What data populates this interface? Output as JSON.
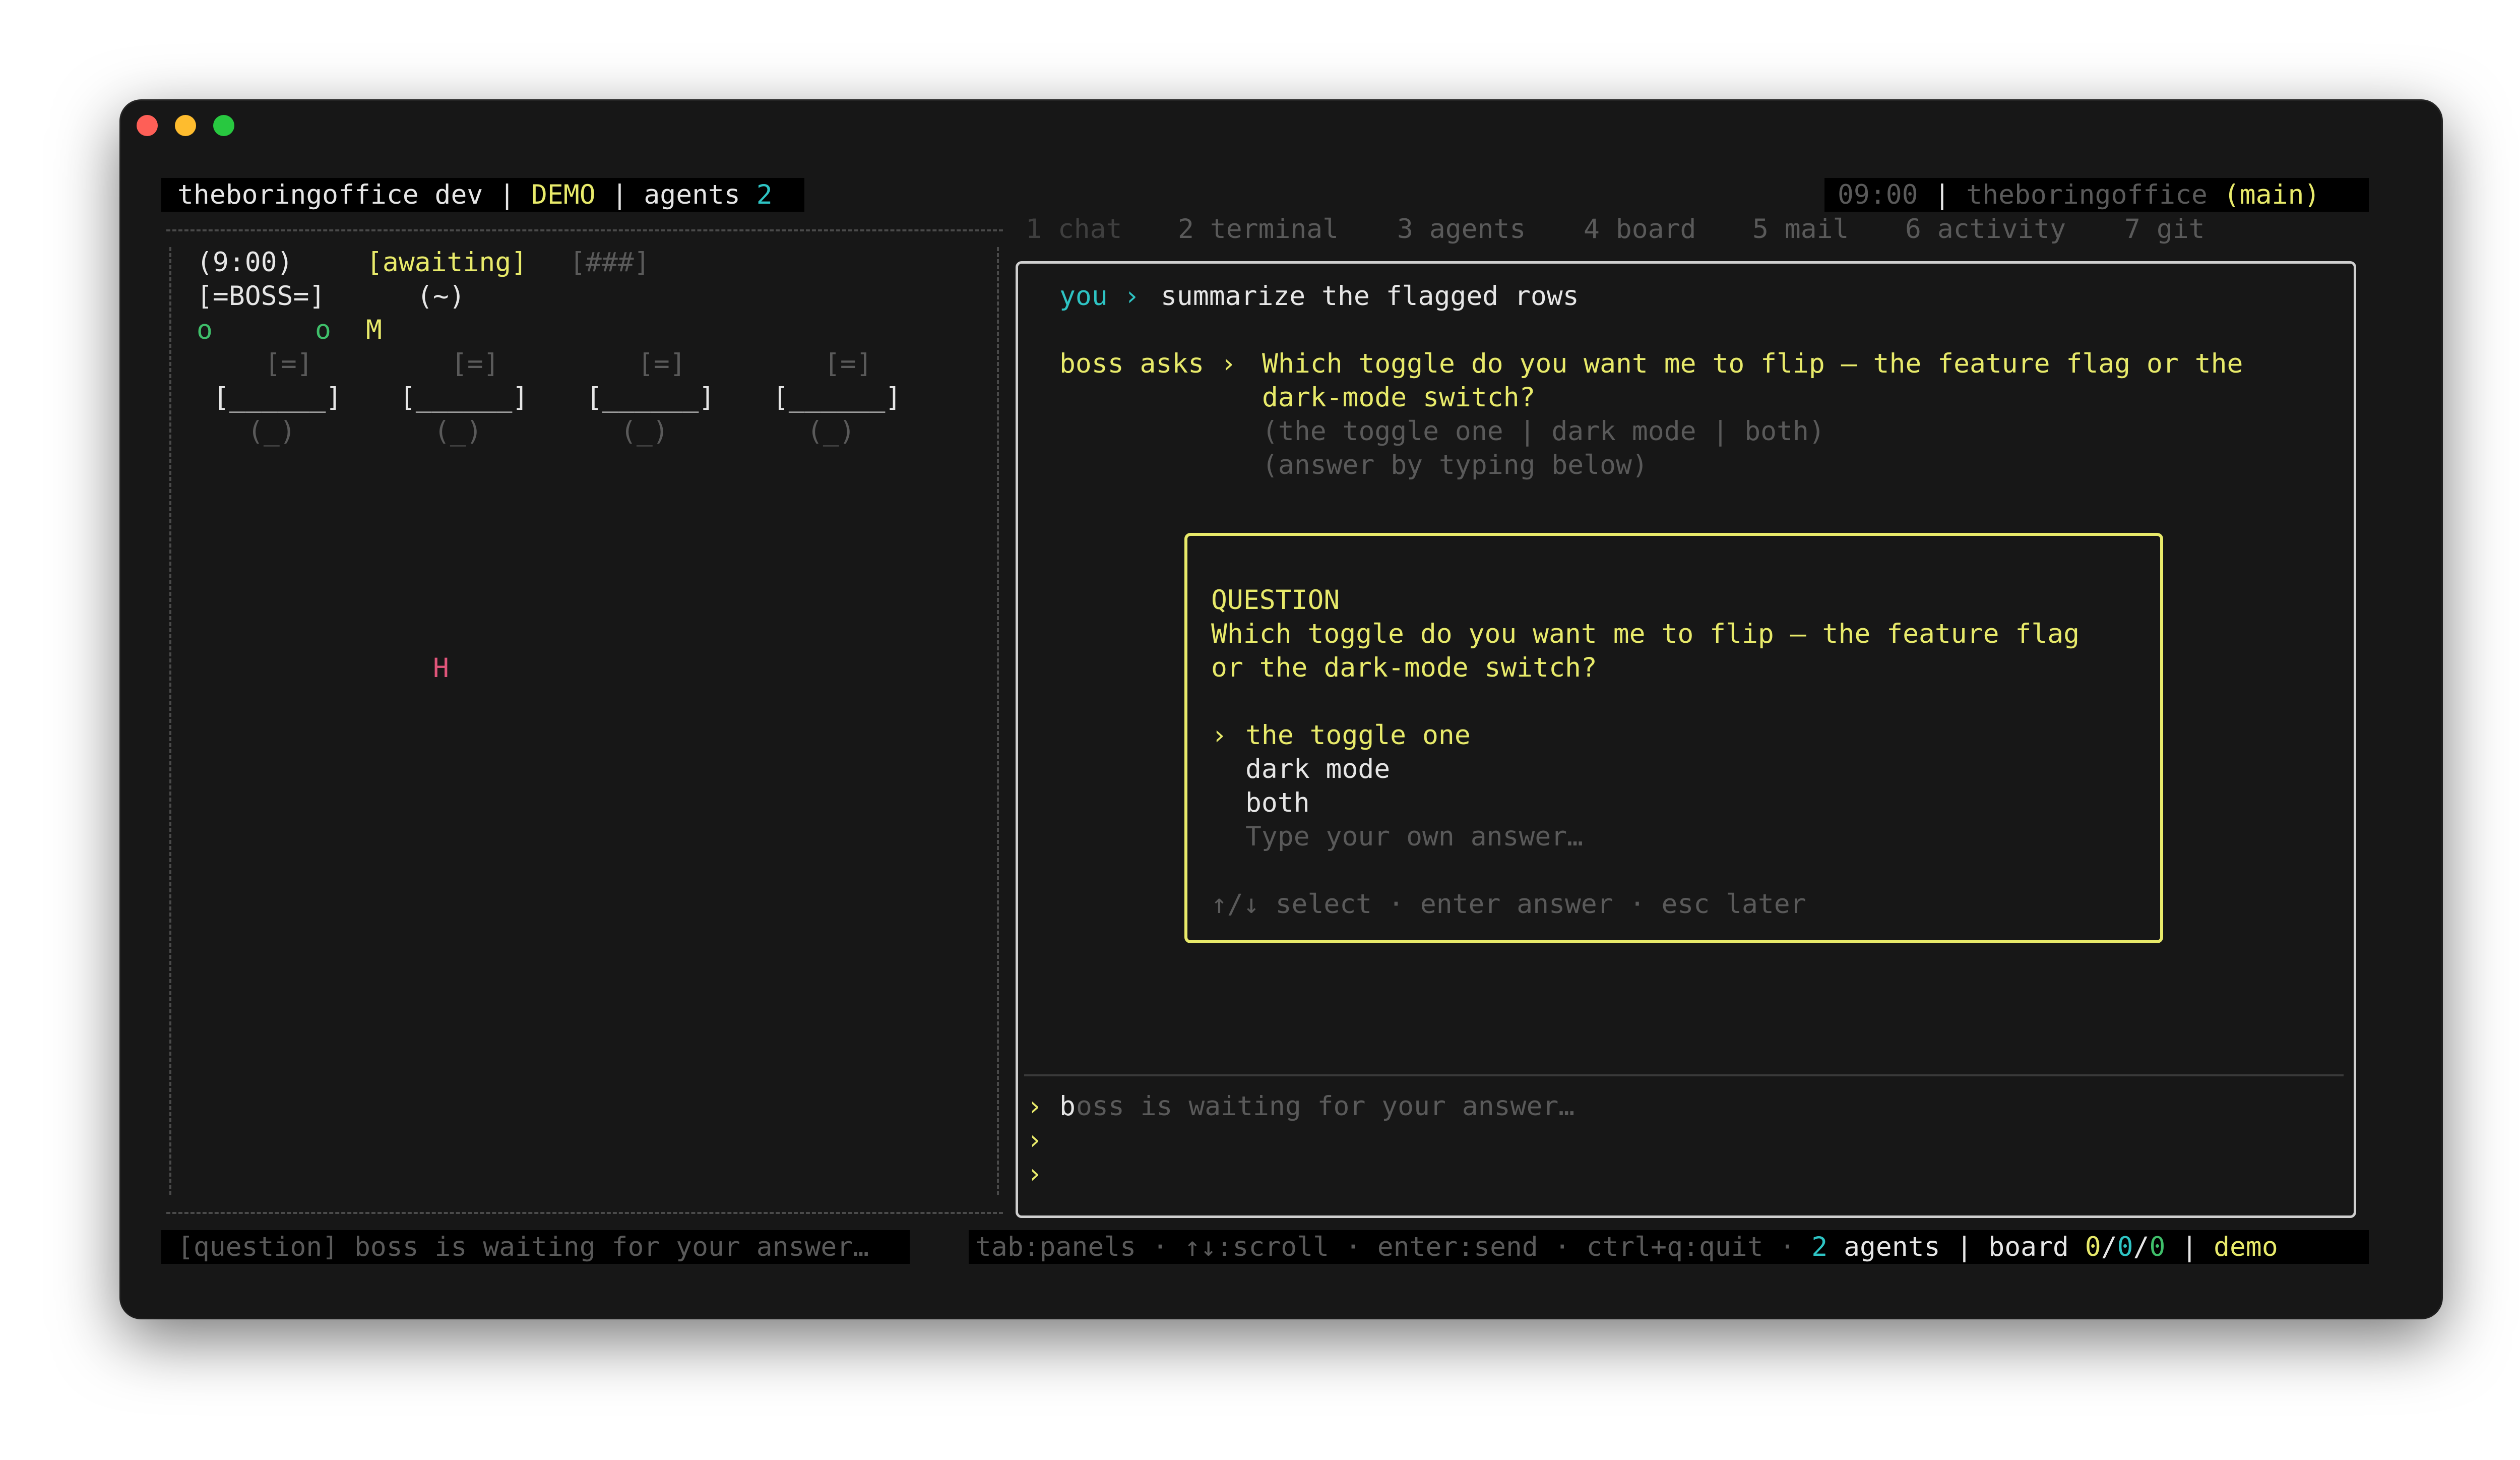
{
  "colors": {
    "accent_yellow": "#e8ea6a",
    "accent_cyan": "#2ec4c4",
    "green": "#3fbf6a",
    "pink": "#e0557a"
  },
  "header": {
    "app": "theboringoffice dev",
    "sep": " | ",
    "mode": "DEMO",
    "agents_label": "agents",
    "agents_count": "2",
    "time": "09:00",
    "project": "theboringoffice",
    "branch": "(main)"
  },
  "tabs": [
    "1 chat",
    "2 terminal",
    "3 agents",
    "4 board",
    "5 mail",
    "6 activity",
    "7 git"
  ],
  "office": {
    "time": "(9:00)",
    "status": "[awaiting]",
    "progress": "[###]",
    "boss": "[=BOSS=]",
    "tilde": "(~)",
    "agent_a": "o",
    "agent_b": "o",
    "agent_m": "M",
    "monitor": "[=]",
    "desk": "[______]",
    "chair": "(_)",
    "human": "H"
  },
  "chat": {
    "you_label": "you ›",
    "you_message": "summarize the flagged rows",
    "boss_label": "boss asks ›",
    "boss_line1": "Which toggle do you want me to flip — the feature flag or the",
    "boss_line2": "dark-mode switch?",
    "options_hint": "(the toggle one | dark mode | both)",
    "answer_hint": "(answer by typing below)"
  },
  "question": {
    "title": "QUESTION",
    "line1": "Which toggle do you want me to flip — the feature flag",
    "line2": "or the dark-mode switch?",
    "cursor": "›",
    "options": [
      "the toggle one",
      "dark mode",
      "both"
    ],
    "custom_placeholder": "Type your own answer…",
    "help": "↑/↓ select · enter answer · esc later"
  },
  "input": {
    "prompt": "›",
    "cursor_char": "b",
    "placeholder": "oss is waiting for your answer…"
  },
  "statusbar": {
    "left": "[question] boss is waiting for your answer…",
    "keys": "tab:panels · ↑↓:scroll · enter:send · ctrl+q:quit ·",
    "agents_count": "2",
    "agents_label": "agents",
    "board_label": "board",
    "board_a": "0",
    "board_b": "0",
    "board_c": "0",
    "mode": "demo"
  }
}
